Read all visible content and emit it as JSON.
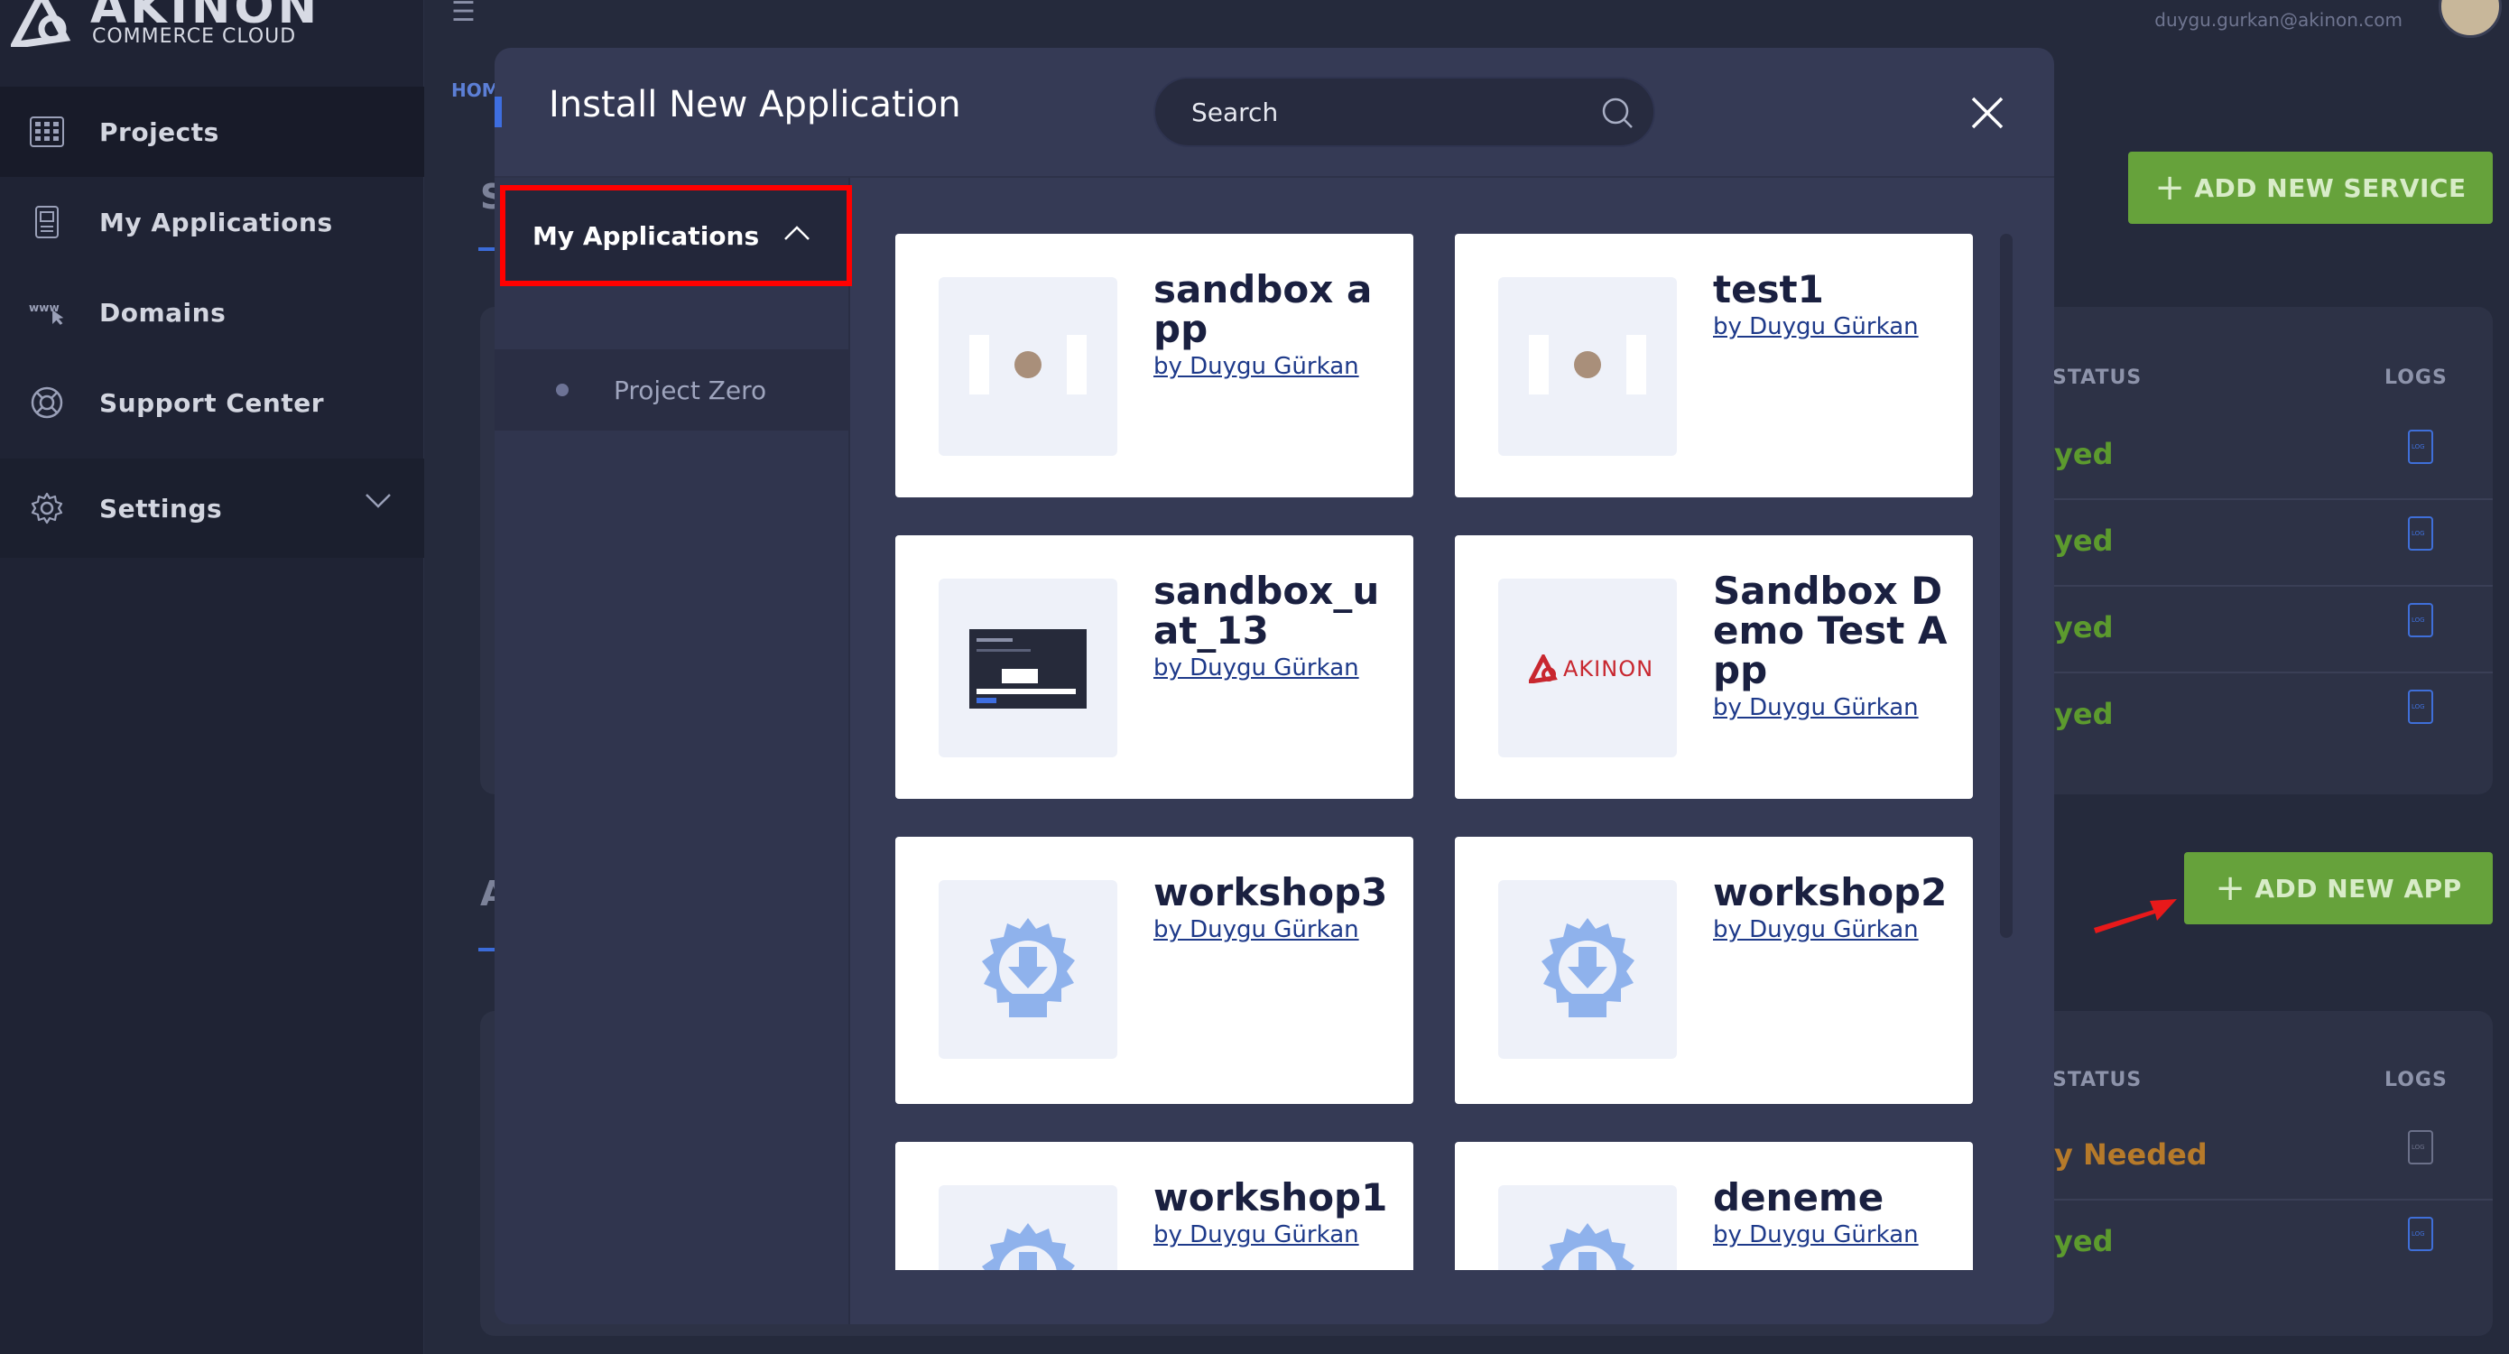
{
  "brand": {
    "name": "AKINON",
    "subtitle": "COMMERCE CLOUD"
  },
  "sidebar": {
    "items": [
      {
        "label": "Projects",
        "icon": "grid-icon"
      },
      {
        "label": "My Applications",
        "icon": "application-icon"
      },
      {
        "label": "Domains",
        "icon": "www-icon"
      },
      {
        "label": "Support Center",
        "icon": "lifebuoy-icon"
      },
      {
        "label": "Settings",
        "icon": "gear-icon"
      }
    ]
  },
  "topbar": {
    "email": "duygu.gurkan@akinon.com"
  },
  "background": {
    "breadcrumb": "HOM",
    "section_letter_1": "S",
    "section_letter_2": "A",
    "add_service_label": "ADD NEW SERVICE",
    "add_app_label": "ADD NEW APP",
    "services_table": {
      "status_header": "STATUS",
      "logs_header": "LOGS",
      "rows": [
        "yed",
        "yed",
        "yed",
        "yed"
      ]
    },
    "apps_table": {
      "status_header": "STATUS",
      "logs_header": "LOGS",
      "rows": [
        "y Needed",
        "yed"
      ]
    }
  },
  "modal": {
    "title": "Install New Application",
    "search_placeholder": "Search",
    "category_label": "My Applications",
    "sub_item_label": "Project Zero",
    "apps": [
      {
        "name": "sandbox app",
        "author": "by Duygu Gürkan",
        "thumb": "avatar"
      },
      {
        "name": "test1",
        "author": "by Duygu Gürkan",
        "thumb": "avatar"
      },
      {
        "name": "sandbox_uat_13",
        "author": "by Duygu Gürkan",
        "thumb": "screenshot"
      },
      {
        "name": "Sandbox Demo Test App",
        "author": "by Duygu Gürkan",
        "thumb": "akinon-logo",
        "thumb_text": "AKINON"
      },
      {
        "name": "workshop3",
        "author": "by Duygu Gürkan",
        "thumb": "gear-download"
      },
      {
        "name": "workshop2",
        "author": "by Duygu Gürkan",
        "thumb": "gear-download"
      },
      {
        "name": "workshop1",
        "author": "by Duygu Gürkan",
        "thumb": "gear-download"
      },
      {
        "name": "deneme",
        "author": "by Duygu Gürkan",
        "thumb": "gear-download"
      }
    ]
  },
  "colors": {
    "accent": "#3e6ee0",
    "green": "#66a23b",
    "highlight": "#ff0000",
    "status_ok": "#5c9a2e",
    "status_warn": "#b67a2a"
  }
}
